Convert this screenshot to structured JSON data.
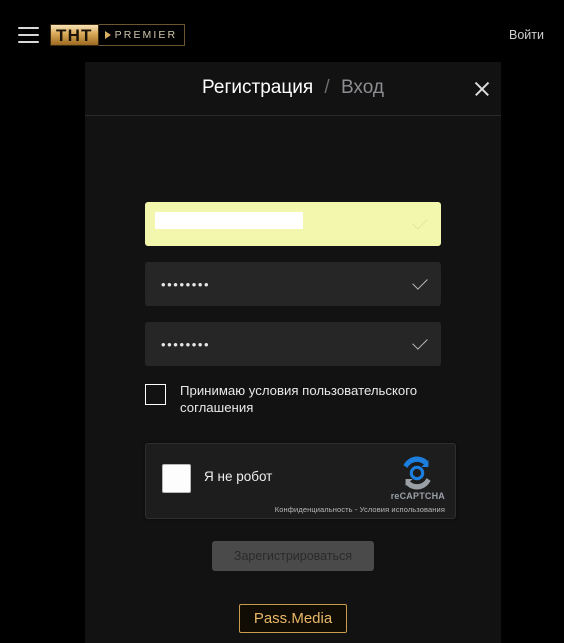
{
  "topbar": {
    "menu_icon": "hamburger-menu-icon",
    "brand": {
      "tnt": "ТНТ",
      "premier": "PREMIER",
      "play_icon": "play-triangle-icon"
    },
    "login_label": "Войти"
  },
  "modal": {
    "tab_register": "Регистрация",
    "tab_separator": "/",
    "tab_login": "Вход",
    "close_icon": "close-x-icon"
  },
  "form": {
    "email": {
      "value": "",
      "placeholder": "",
      "autofilled": true,
      "redacted": true,
      "valid_icon": "checkmark-icon"
    },
    "password": {
      "value": "••••••••",
      "valid_icon": "checkmark-icon"
    },
    "password_repeat": {
      "value": "••••••••",
      "valid_icon": "checkmark-icon"
    },
    "agreement": {
      "label": "Принимаю условия пользовательского соглашения",
      "checked": false
    },
    "submit_label": "Зарегистрироваться",
    "submit_disabled": true
  },
  "recaptcha": {
    "label": "Я не робот",
    "checked": false,
    "brand": "reCAPTCHA",
    "privacy": "Конфиденциальность",
    "terms_separator": " - ",
    "terms": "Условия использования",
    "logo_icon": "recaptcha-logo-icon"
  },
  "footer": {
    "passmedia_label": "Pass.Media"
  },
  "colors": {
    "page_background": "#000000",
    "modal_background": "#121212",
    "field_background": "#262626",
    "autofill_background": "#f3f7ae",
    "accent_gold": "#e8b868",
    "recaptcha_blue": "#1c7fe0",
    "recaptcha_gray": "#9aa0a6",
    "text_primary": "#ffffff",
    "text_muted": "#8d8d92"
  }
}
